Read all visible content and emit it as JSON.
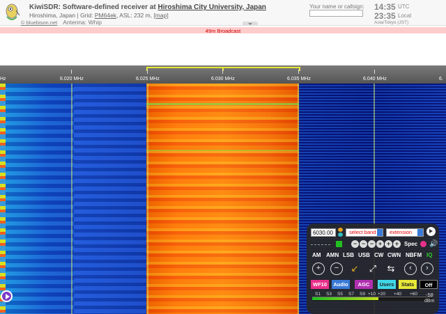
{
  "header": {
    "title_prefix": "KiwiSDR: Software-defined receiver at ",
    "title_link": "Hiroshima City University, Japan",
    "location": "Hiroshima, Japan | Grid: ",
    "grid": "PM64ek",
    "asl": ", ASL: 232 m, ",
    "map_link": "[map]",
    "site_link": "© bluebison.net",
    "antenna": "Antenna: Whip",
    "name_label": "Your name or callsign:",
    "name_value": "",
    "utc_time": "14:35",
    "utc_label": "UTC",
    "local_time": "23:35",
    "local_label": "Local",
    "timezone": "Asia/Tokyo (JST)"
  },
  "band_bar": {
    "label": "49m Broadcast"
  },
  "scale": {
    "ticks": [
      "Hz",
      "6.020 MHz",
      "6.025 MHz",
      "6.030 MHz",
      "6.035 MHz",
      "6.040 MHz",
      "6."
    ]
  },
  "panel": {
    "frequency": "6030.00",
    "band_select": "select band",
    "ext_select": "extension",
    "zoom_buttons": [
      "−",
      "−",
      "−",
      "+",
      "+",
      "+"
    ],
    "spec_label": "Spec",
    "modes": [
      "AM",
      "AMN",
      "LSB",
      "USB",
      "CW",
      "CWN",
      "NBFM",
      "IQ"
    ],
    "buttons": {
      "wf": "WF10",
      "audio": "Audio",
      "agc": "AGC",
      "users": "Users",
      "stats": "Stats",
      "off": "Off"
    },
    "smeter": {
      "labels": [
        "S1",
        "S3",
        "S5",
        "S7",
        "S9",
        "+10",
        "+20",
        "+40",
        "+60"
      ],
      "dbm_value": "-58",
      "dbm_unit": "dBm",
      "level": 0.55
    }
  },
  "colors": {
    "band_bar_bg": "#ffcccc",
    "band_bar_text": "#cc0000",
    "passband": "#e8e838",
    "panel_bg": "#282828"
  }
}
